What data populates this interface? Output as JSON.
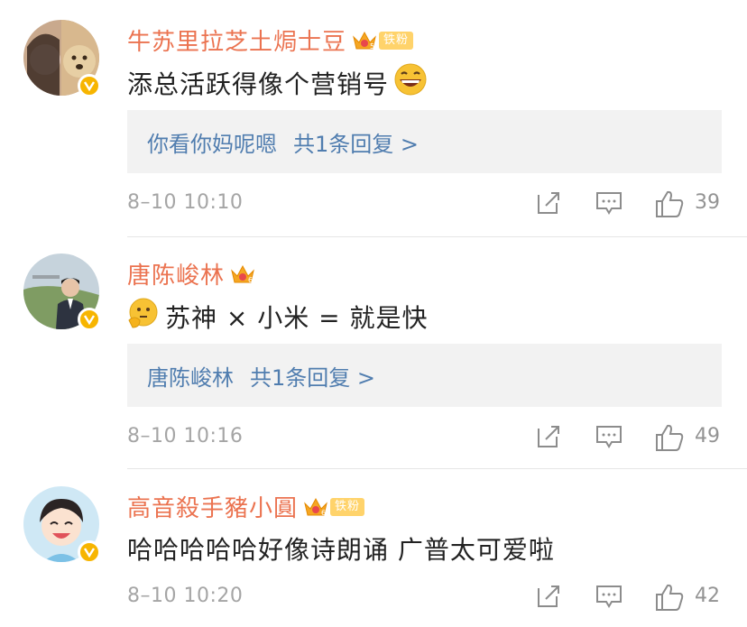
{
  "comments": [
    {
      "username": "牛苏里拉芝土焗士豆",
      "fan_tag": "铁粉",
      "text": "添总活跃得像个营销号",
      "reply": {
        "name": "你看你妈呢嗯",
        "more": "共1条回复 >"
      },
      "time": "8–10 10:10",
      "likes": "39"
    },
    {
      "username": "唐陈峻林",
      "fan_tag": "",
      "text": "苏神 × 小米 = 就是快",
      "reply": {
        "name": "唐陈峻林",
        "more": "共1条回复 >"
      },
      "time": "8–10 10:16",
      "likes": "49"
    },
    {
      "username": "高音殺手豬小圓",
      "fan_tag": "铁粉",
      "text": "哈哈哈哈哈好像诗朗诵 广普太可爱啦",
      "time": "8–10 10:20",
      "likes": "42"
    }
  ],
  "colors": {
    "username": "#eb7350",
    "reply_link": "#507daf",
    "verified": "#f7b500"
  }
}
